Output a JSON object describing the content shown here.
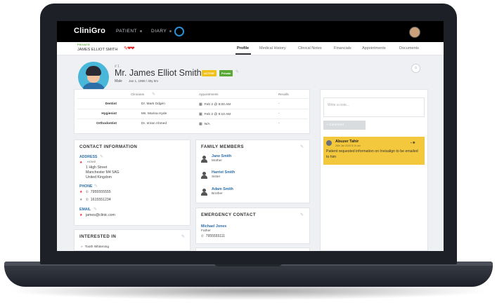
{
  "app": {
    "logo": "CliniGro",
    "nav": [
      "PATIENT",
      "DIARY"
    ]
  },
  "subbar": {
    "privacy_tag": "PRIVATE",
    "patient_name": "JAMES ELLIOT SMITH",
    "alert_icons": "✎❤❤",
    "tabs": [
      "Profile",
      "Medical History",
      "Clinical Notes",
      "Financials",
      "Appointments",
      "Documents"
    ],
    "active_tab": "Profile"
  },
  "patient": {
    "number": "# 1",
    "name": "Mr. James Elliot Smith",
    "status_badge": "ACTIVE",
    "type_badge": "Private",
    "gender": "Male",
    "dob": "Jan 1, 1990 / 30y 0m"
  },
  "clinicians": {
    "headers": [
      "Clinicians",
      "Appointments",
      "Recalls"
    ],
    "rows": [
      {
        "role": "Dentist",
        "clinician": "Dr. Mark Odgen",
        "appointment": "Feb 2 @ 9:00 AM",
        "recall": "-"
      },
      {
        "role": "Hygienist",
        "clinician": "Ms. Marina Hyde",
        "appointment": "Feb 2 @ 9:10 AM",
        "recall": "-"
      },
      {
        "role": "Orthodontist",
        "clinician": "Dr. Imran Ahmed",
        "appointment": "N/A",
        "recall": "-"
      }
    ]
  },
  "notes": {
    "placeholder": "Write a note...",
    "button": "+ Comment",
    "items": [
      {
        "author": "Abuzer Tahir",
        "date": "26th Jan 2020 8:19 am",
        "text": "Patient requested information on Invisalign to be emailed to him"
      }
    ]
  },
  "contact": {
    "title": "CONTACT INFORMATION",
    "address_label": "ADDRESS",
    "address_type": "HOME",
    "address_lines": [
      "1 High Street",
      "Manchester M4 5AG",
      "United Kingdom"
    ],
    "phone_label": "PHONE",
    "phones": [
      "7955555555",
      "1615551234"
    ],
    "email_label": "EMAIL",
    "email": "james@clinic.com"
  },
  "interested": {
    "title": "INTERESTED IN",
    "items": [
      "Tooth Whitening"
    ]
  },
  "family": {
    "title": "FAMILY MEMBERS",
    "members": [
      {
        "name": "Jane Smith",
        "relation": "Mother"
      },
      {
        "name": "Harriet Smith",
        "relation": "Sister"
      },
      {
        "name": "Adam Smith",
        "relation": "Brother"
      }
    ]
  },
  "emergency": {
    "title": "EMERGENCY CONTACT",
    "name": "Michael Jones",
    "relation": "Father",
    "phone": "7955555111"
  }
}
